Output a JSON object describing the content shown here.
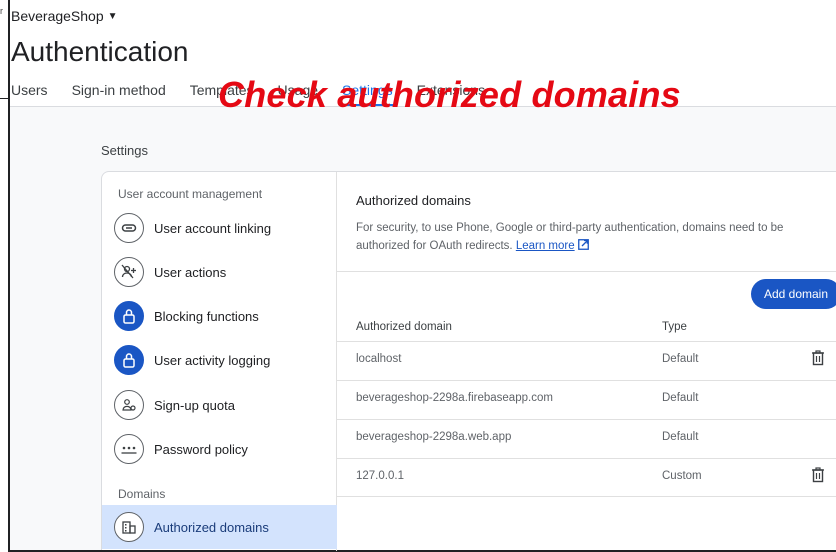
{
  "left_snip": "r",
  "project": {
    "name": "BeverageShop"
  },
  "page_title": "Authentication",
  "tabs": [
    {
      "label": "Users",
      "active": false
    },
    {
      "label": "Sign-in method",
      "active": false
    },
    {
      "label": "Templates",
      "active": false
    },
    {
      "label": "Usage",
      "active": false
    },
    {
      "label": "Settings",
      "active": true
    },
    {
      "label": "Extensions",
      "active": false
    }
  ],
  "overlay_caption": "Check authorized domains",
  "settings_label": "Settings",
  "nav": {
    "group_user": "User account management",
    "group_domains": "Domains",
    "items": [
      {
        "label": "User account linking",
        "icon": "link-icon"
      },
      {
        "label": "User actions",
        "icon": "person-add-off-icon"
      },
      {
        "label": "Blocking functions",
        "icon": "lock-icon"
      },
      {
        "label": "User activity logging",
        "icon": "lock-icon"
      },
      {
        "label": "Sign-up quota",
        "icon": "group-icon"
      },
      {
        "label": "Password policy",
        "icon": "password-icon"
      },
      {
        "label": "Authorized domains",
        "icon": "domain-icon"
      }
    ]
  },
  "panel": {
    "title": "Authorized domains",
    "description": "For security, to use Phone, Google or third-party authentication, domains need to be authorized for OAuth redirects.",
    "learn_more": "Learn more",
    "add_button": "Add domain",
    "columns": [
      "Authorized domain",
      "Type"
    ],
    "rows": [
      {
        "domain": "localhost",
        "type": "Default",
        "deletable": true
      },
      {
        "domain": "beverageshop-2298a.firebaseapp.com",
        "type": "Default",
        "deletable": false
      },
      {
        "domain": "beverageshop-2298a.web.app",
        "type": "Default",
        "deletable": false
      },
      {
        "domain": "127.0.0.1",
        "type": "Custom",
        "deletable": true
      }
    ]
  },
  "colors": {
    "accent": "#1a56c4",
    "overlay_red": "#e50914",
    "active_nav": "#d3e3fd"
  }
}
